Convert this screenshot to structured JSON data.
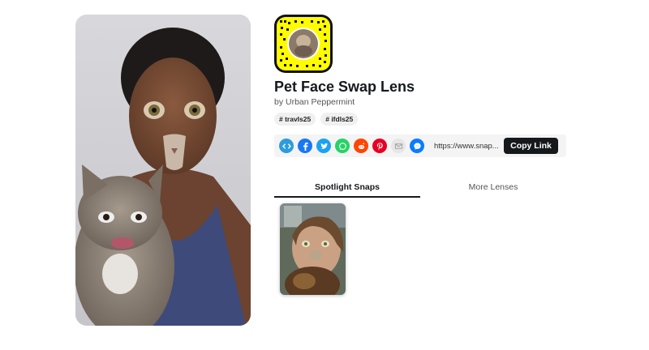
{
  "lens": {
    "title": "Pet Face Swap Lens",
    "creator": "by Urban Peppermint",
    "tags": [
      "# travls25",
      "# ifdls25"
    ]
  },
  "share": {
    "icons": [
      {
        "name": "embed-icon",
        "glyph": "</>",
        "color": "#2d9cdb"
      },
      {
        "name": "facebook-icon",
        "glyph": "f",
        "color": "#1877f2"
      },
      {
        "name": "twitter-icon",
        "glyph": "t",
        "color": "#1da1f2"
      },
      {
        "name": "whatsapp-icon",
        "glyph": "w",
        "color": "#25d366"
      },
      {
        "name": "reddit-icon",
        "glyph": "r",
        "color": "#ff4500"
      },
      {
        "name": "pinterest-icon",
        "glyph": "p",
        "color": "#e60023"
      },
      {
        "name": "email-icon",
        "glyph": "✉",
        "color": "#e6e6e6"
      },
      {
        "name": "messenger-icon",
        "glyph": "m",
        "color": "#0a7cff"
      }
    ],
    "url": "https://www.snap...",
    "copy_label": "Copy Link"
  },
  "tabs": {
    "spotlight": "Spotlight Snaps",
    "more": "More Lenses"
  },
  "colors": {
    "snapcode_yellow": "#FFFC00",
    "text_dark": "#16191c"
  }
}
